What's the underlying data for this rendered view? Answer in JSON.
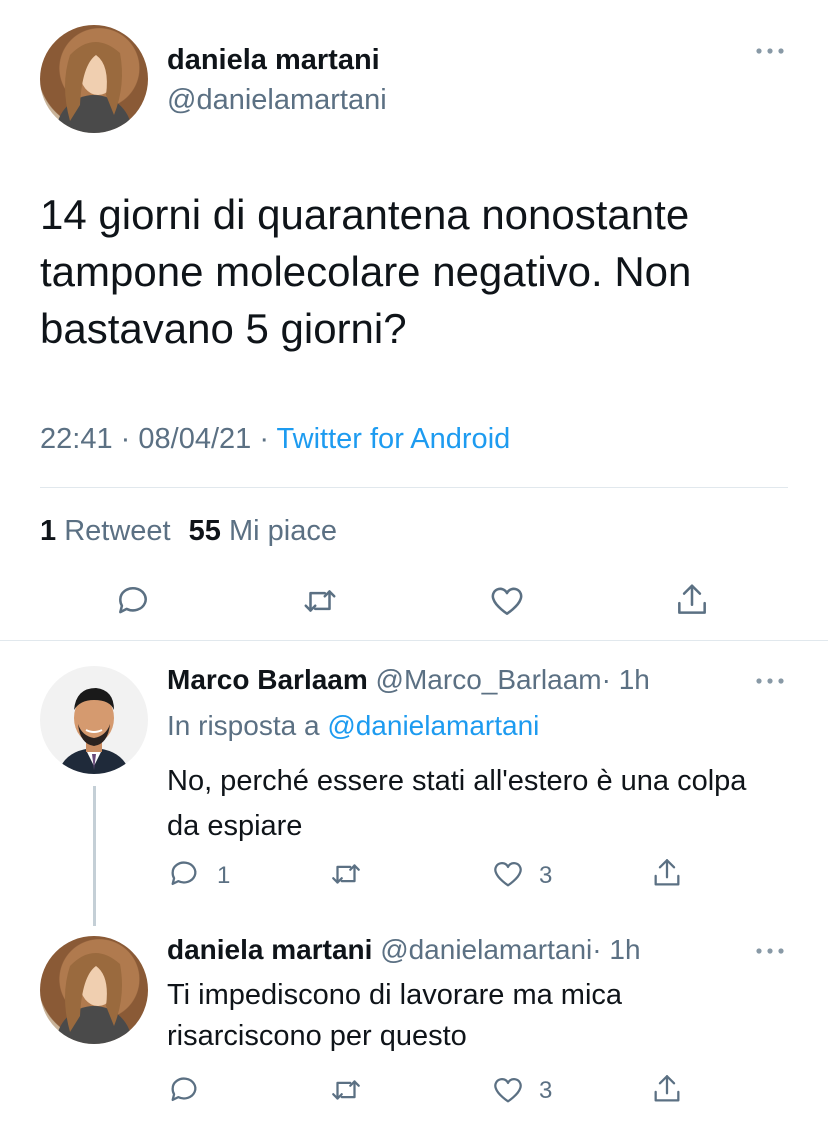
{
  "main_tweet": {
    "author_name": "daniela martani",
    "author_handle": "@danielamartani",
    "text": "14 giorni di quarantena nonostante tampone molecolare negativo. Non bastavano 5 giorni?",
    "time": "22:41",
    "dot1": "·",
    "date": "08/04/21",
    "dot2": "·",
    "source": "Twitter for Android",
    "retweets_count": "1",
    "retweets_label": "Retweet",
    "likes_count": "55",
    "likes_label": "Mi piace"
  },
  "replies": [
    {
      "author_name": "Marco Barlaam",
      "author_handle": "@Marco_Barlaam",
      "time_ago": "· 1h",
      "reply_to_label": "In risposta a",
      "reply_to_handle": "@danielamartani",
      "text": "No, perché essere stati all'estero è una colpa da espiare",
      "reply_count": "1",
      "like_count": "3"
    },
    {
      "author_name": "daniela martani",
      "author_handle": "@danielamartani",
      "time_ago": "· 1h",
      "text": "Ti impediscono di lavorare ma mica risarciscono per questo",
      "like_count": "3"
    }
  ],
  "icons": {
    "reply": "reply-icon",
    "retweet": "retweet-icon",
    "like": "heart-icon",
    "share": "share-icon",
    "more": "more-icon"
  },
  "colors": {
    "link": "#1d9bf0",
    "muted": "#5b7083",
    "divider": "#e1e8ed"
  }
}
